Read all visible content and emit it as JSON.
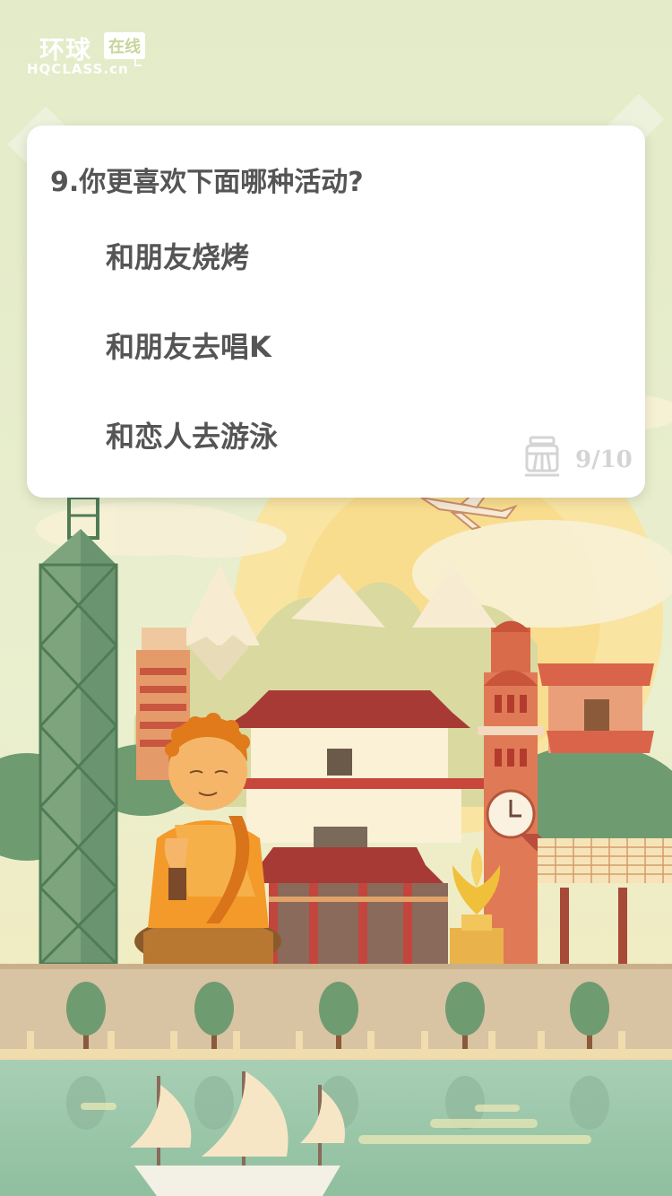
{
  "logo": {
    "main": "环球",
    "badge": "在线",
    "sub": "HQCLASS.cn"
  },
  "quiz": {
    "question": "9.你更喜欢下面哪种活动?",
    "options": [
      {
        "label": "和朋友烧烤"
      },
      {
        "label": "和朋友去唱K"
      },
      {
        "label": "和恋人去游泳"
      }
    ],
    "progress": "9/10",
    "progress_icon": "tram-icon"
  },
  "colors": {
    "background": "#e3ebc8",
    "text": "#555555",
    "progress": "#d4d4d4"
  }
}
